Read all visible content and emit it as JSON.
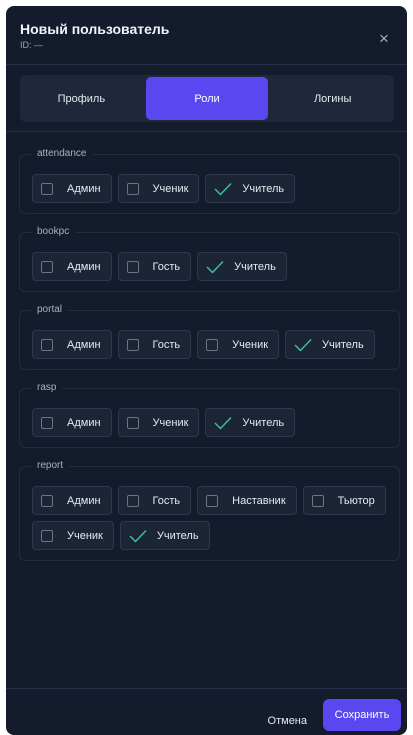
{
  "dialog": {
    "title": "Новый пользователь",
    "id_label": "ID: —",
    "close_glyph": "×"
  },
  "tabs": [
    {
      "label": "Профиль",
      "active": false
    },
    {
      "label": "Роли",
      "active": true
    },
    {
      "label": "Логины",
      "active": false
    }
  ],
  "groups": [
    {
      "name": "attendance",
      "options": [
        {
          "label": "Админ",
          "checked": false
        },
        {
          "label": "Ученик",
          "checked": false
        },
        {
          "label": "Учитель",
          "checked": true
        }
      ]
    },
    {
      "name": "bookpc",
      "options": [
        {
          "label": "Админ",
          "checked": false
        },
        {
          "label": "Гость",
          "checked": false
        },
        {
          "label": "Учитель",
          "checked": true
        }
      ]
    },
    {
      "name": "portal",
      "options": [
        {
          "label": "Админ",
          "checked": false
        },
        {
          "label": "Гость",
          "checked": false
        },
        {
          "label": "Ученик",
          "checked": false
        },
        {
          "label": "Учитель",
          "checked": true
        }
      ]
    },
    {
      "name": "rasp",
      "options": [
        {
          "label": "Админ",
          "checked": false
        },
        {
          "label": "Ученик",
          "checked": false
        },
        {
          "label": "Учитель",
          "checked": true
        }
      ]
    },
    {
      "name": "report",
      "options": [
        {
          "label": "Админ",
          "checked": false
        },
        {
          "label": "Гость",
          "checked": false
        },
        {
          "label": "Наставник",
          "checked": false
        },
        {
          "label": "Тьютор",
          "checked": false
        },
        {
          "label": "Ученик",
          "checked": false
        },
        {
          "label": "Учитель",
          "checked": true
        }
      ]
    }
  ],
  "footer": {
    "cancel_label": "Отмена",
    "save_label": "Сохранить"
  },
  "colors": {
    "background": "#141b2d",
    "accent": "#5b47ef",
    "check": "#3fc1a5"
  }
}
